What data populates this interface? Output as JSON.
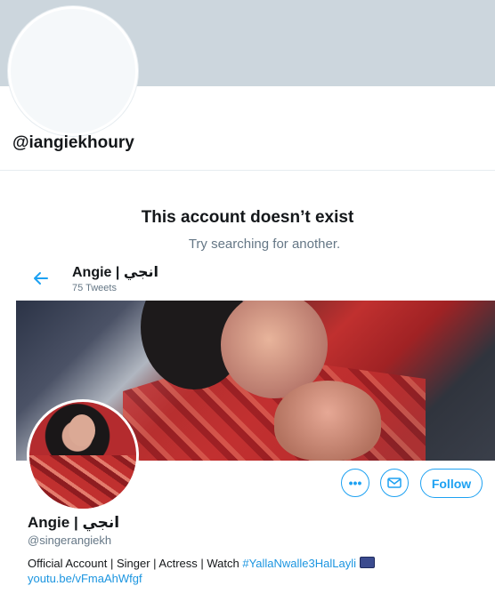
{
  "top_profile": {
    "handle": "@iangiekhoury"
  },
  "not_exist": {
    "title": "This account doesn’t exist",
    "subtitle": "Try searching for another."
  },
  "embedded_profile": {
    "header_name": "Angie | انجي",
    "tweet_count": "75 Tweets",
    "name": "Angie | انجي",
    "handle": "@singerangiekh",
    "bio_text": "Official Account | Singer | Actress | Watch ",
    "bio_hashtag": "#YallaNwalle3HalLayli",
    "url": "youtu.be/vFmaAhWfgf",
    "buttons": {
      "more_label": "•••",
      "follow_label": "Follow"
    },
    "icons": {
      "back": "back-arrow-icon",
      "message": "envelope-icon",
      "tv": "tv-emoji-icon"
    }
  },
  "colors": {
    "accent": "#1da1f2",
    "link": "#1b95e0",
    "muted": "#657786",
    "banner_placeholder": "#ccd6dd"
  }
}
